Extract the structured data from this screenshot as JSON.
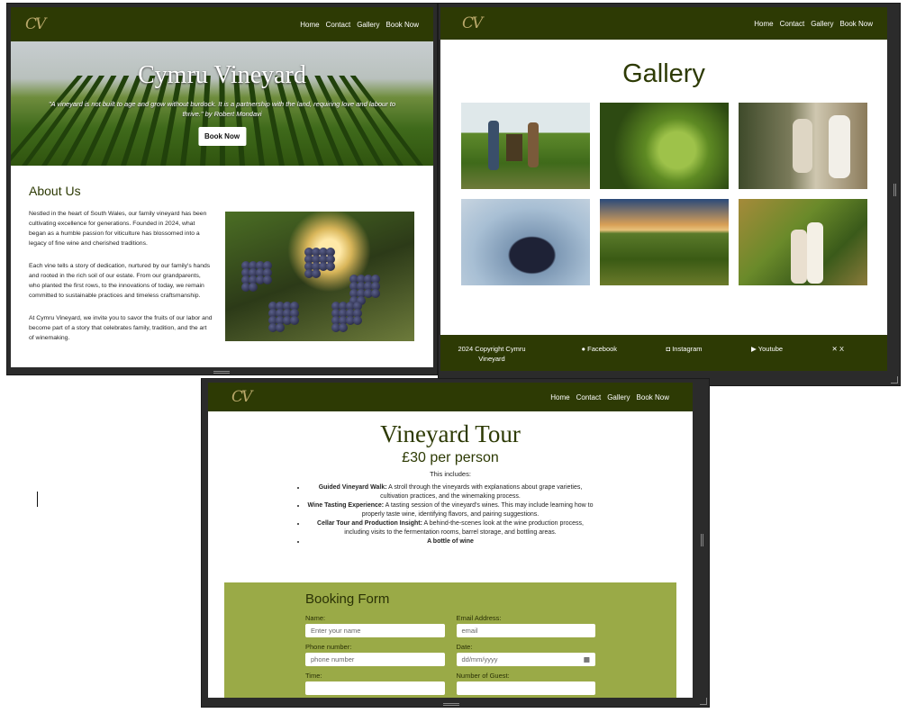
{
  "nav": {
    "logo": "CV",
    "links": [
      "Home",
      "Contact",
      "Gallery",
      "Book Now"
    ]
  },
  "home": {
    "hero_title": "Cymru Vineyard",
    "hero_quote": "\"A vineyard is not built to age and grow without burdock. It is a partnership with the land, requiring love and labour to thrive.\" by Robert Mondavi",
    "hero_button": "Book Now",
    "about_heading": "About Us",
    "paragraphs": [
      "Nestled in the heart of South Wales, our family vineyard has been cultivating excellence for generations. Founded in 2024, what began as a humble passion for viticulture has blossomed into a legacy of fine wine and cherished traditions.",
      "Each vine tells a story of dedication, nurtured by our family's hands and rooted in the rich soil of our estate. From our grandparents, who planted the first rows, to the innovations of today, we remain committed to sustainable practices and timeless craftsmanship.",
      "At Cymru Vineyard, we invite you to savor the fruits of our labor and become part of a story that celebrates family, tradition, and the art of winemaking."
    ]
  },
  "gallery": {
    "title": "Gallery",
    "images": [
      "couple-harvest-photo",
      "green-grapes-photo",
      "wine-tasting-photo",
      "hands-grapes-photo",
      "vineyard-sunset-photo",
      "couple-vineyard-photo"
    ]
  },
  "footer": {
    "copyright": "2024 Copyright Cymru Vineyard",
    "links": [
      {
        "icon": "facebook-icon",
        "label": "Facebook"
      },
      {
        "icon": "instagram-icon",
        "label": "Instagram"
      },
      {
        "icon": "youtube-icon",
        "label": "Youtube"
      },
      {
        "icon": "x-icon",
        "label": "X"
      }
    ]
  },
  "tour": {
    "title": "Vineyard Tour",
    "price": "£30 per person",
    "includes": "This includes:",
    "items": [
      {
        "bold": "Guided Vineyard Walk:",
        "text": " A stroll through the vineyards with explanations about grape varieties, cultivation practices, and the winemaking process."
      },
      {
        "bold": "Wine Tasting Experience:",
        "text": " A tasting session of the vineyard's wines. This may include learning how to properly taste wine, identifying flavors, and pairing suggestions."
      },
      {
        "bold": "Cellar Tour and Production Insight:",
        "text": " A behind-the-scenes look at the wine production process, including visits to the fermentation rooms, barrel storage, and bottling areas."
      },
      {
        "bold": "A bottle of wine",
        "text": ""
      }
    ],
    "form": {
      "title": "Booking Form",
      "name_label": "Name:",
      "name_placeholder": "Enter your name",
      "email_label": "Email Address:",
      "email_placeholder": "email",
      "phone_label": "Phone number:",
      "phone_placeholder": "phone number",
      "date_label": "Date:",
      "date_placeholder": "dd/mm/yyyy",
      "time_label": "Time:",
      "guests_label": "Number of Guest:"
    }
  },
  "colors": {
    "nav": "#2d3a04",
    "form_bg": "#9aaa47",
    "heading": "#2d3a04"
  }
}
